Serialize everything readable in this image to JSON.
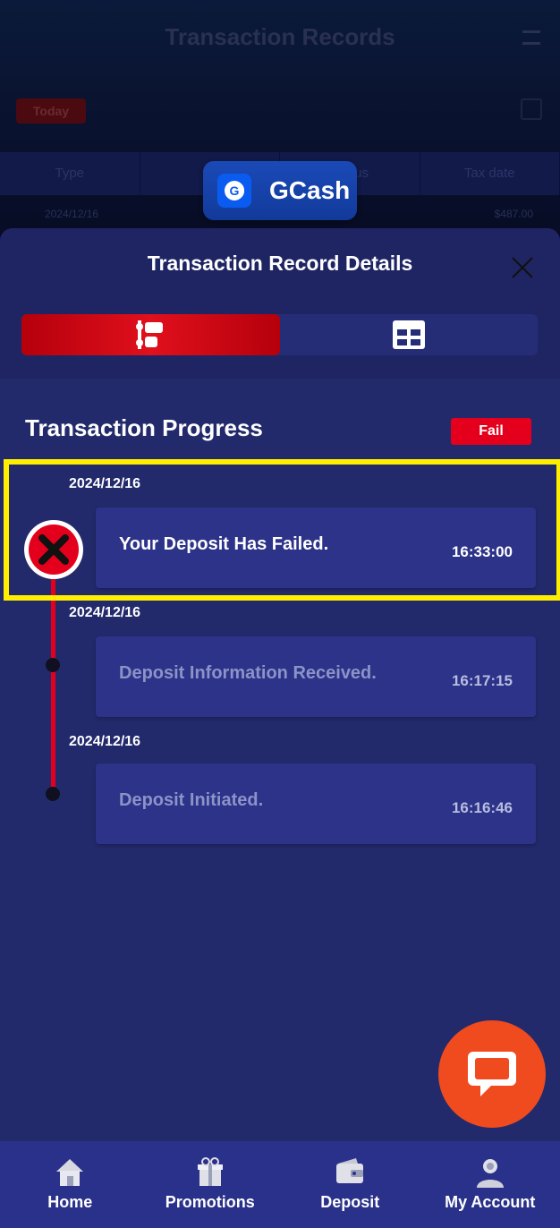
{
  "background": {
    "title": "Transaction Records",
    "chip": "Today",
    "table_headers": [
      "Type",
      "",
      "Status",
      "Tax date"
    ],
    "row_date": "2024/12/16",
    "row_amount": "$487.00"
  },
  "gcash": {
    "label": "GCash",
    "icon": "gcash-logo-icon"
  },
  "modal": {
    "title": "Transaction Record Details",
    "tabs": [
      {
        "icon": "timeline-icon",
        "active": true
      },
      {
        "icon": "grid-icon",
        "active": false
      }
    ]
  },
  "progress": {
    "title": "Transaction Progress",
    "status": "Fail",
    "steps": [
      {
        "date": "2024/12/16",
        "message": "Your Deposit Has Failed.",
        "time": "16:33:00"
      },
      {
        "date": "2024/12/16",
        "message": "Deposit Information Received.",
        "time": "16:17:15"
      },
      {
        "date": "2024/12/16",
        "message": "Deposit Initiated.",
        "time": "16:16:46"
      }
    ]
  },
  "nav": {
    "items": [
      {
        "label": "Home",
        "icon": "home-icon"
      },
      {
        "label": "Promotions",
        "icon": "gift-icon"
      },
      {
        "label": "Deposit",
        "icon": "wallet-icon"
      },
      {
        "label": "My Account",
        "icon": "user-icon"
      }
    ]
  },
  "colors": {
    "accent_red": "#e4001c",
    "highlight": "#ffee00",
    "chat": "#ef4b1e"
  }
}
